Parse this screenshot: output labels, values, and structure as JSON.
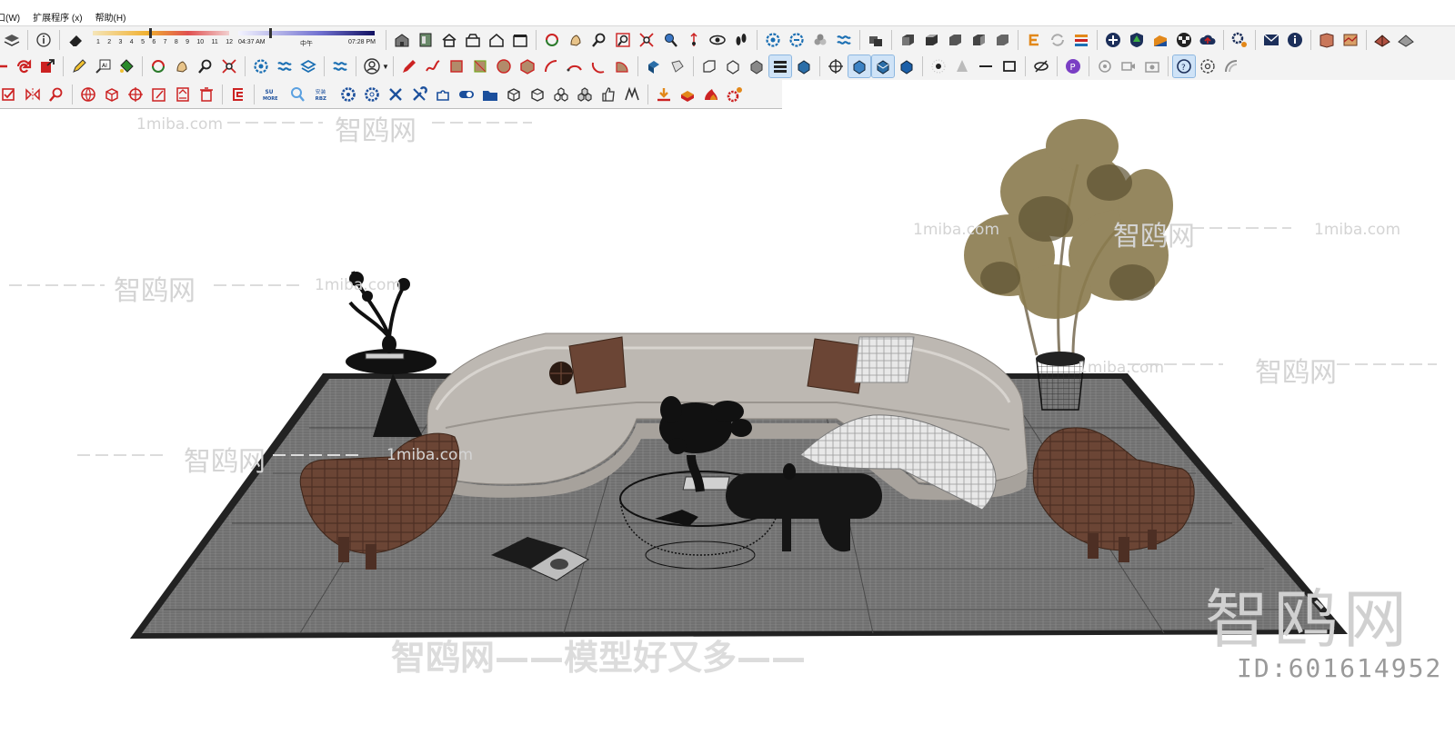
{
  "menu": {
    "window": "口(W)",
    "extensions": "扩展程序 (x)",
    "help": "帮助(H)"
  },
  "shadow_widget": {
    "months": [
      "1",
      "2",
      "3",
      "4",
      "5",
      "6",
      "7",
      "8",
      "9",
      "10",
      "11",
      "12"
    ],
    "time_start": "04:37 AM",
    "time_noon": "中午",
    "time_end": "07:28 PM"
  },
  "toolbar_text": {
    "su_more": "SU MORE",
    "install_rbz": "安装 RBZ"
  },
  "watermarks": {
    "site": "1miba.com",
    "brand": "智鸥网",
    "slogan": "智鸥网——模型好又多——",
    "id": "ID:601614952"
  },
  "colors": {
    "toolbar_bg": "#f3f3f3",
    "rug": "#6e6e6e",
    "sofa": "#bdb8b2",
    "leather": "#6b4535",
    "dark": "#151515"
  }
}
